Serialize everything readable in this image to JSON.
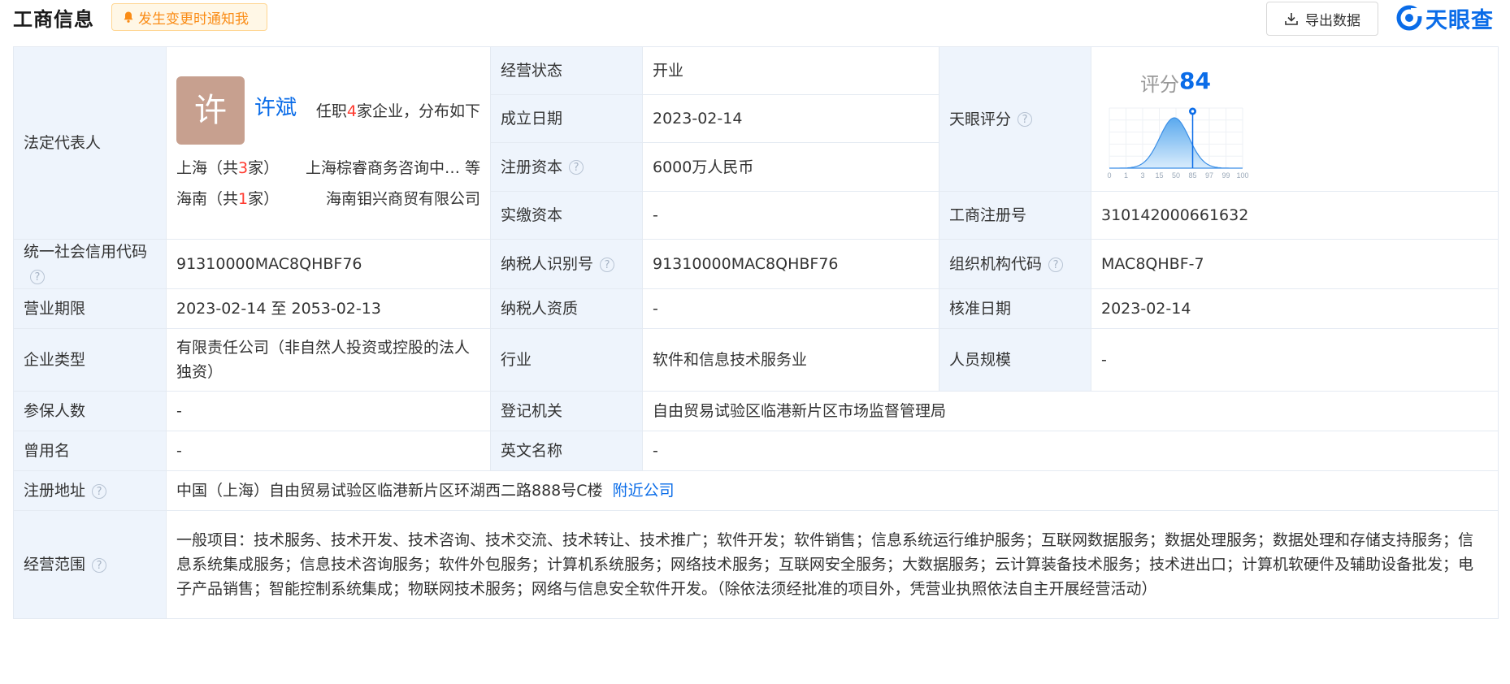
{
  "header": {
    "title": "工商信息",
    "notify_label": "发生变更时通知我",
    "export_label": "导出数据",
    "logo_text": "天眼查"
  },
  "legal_rep": {
    "label": "法定代表人",
    "avatar_char": "许",
    "name": "许斌",
    "pos_prefix": "任职",
    "pos_count": "4",
    "pos_suffix": "家企业，分布如下",
    "regions": [
      {
        "prefix": "上海（共",
        "count": "3",
        "suffix": "家）",
        "company": "上海棕睿商务咨询中…  等"
      },
      {
        "prefix": "海南（共",
        "count": "1",
        "suffix": "家）",
        "company": "海南钼兴商贸有限公司"
      }
    ]
  },
  "fields": {
    "status": {
      "label": "经营状态",
      "value": "开业"
    },
    "established": {
      "label": "成立日期",
      "value": "2023-02-14"
    },
    "reg_capital": {
      "label": "注册资本",
      "value": "6000万人民币"
    },
    "paid_capital": {
      "label": "实缴资本",
      "value": "-"
    },
    "tianyan_score": {
      "label": "天眼评分"
    },
    "reg_no": {
      "label": "工商注册号",
      "value": "310142000661632"
    },
    "credit_code": {
      "label": "统一社会信用代码",
      "value": "91310000MAC8QHBF76"
    },
    "taxpayer_id": {
      "label": "纳税人识别号",
      "value": "91310000MAC8QHBF76"
    },
    "org_code": {
      "label": "组织机构代码",
      "value": "MAC8QHBF-7"
    },
    "term": {
      "label": "营业期限",
      "value": "2023-02-14 至 2053-02-13"
    },
    "taxpayer_qual": {
      "label": "纳税人资质",
      "value": "-"
    },
    "approval_date": {
      "label": "核准日期",
      "value": "2023-02-14"
    },
    "company_type": {
      "label": "企业类型",
      "value": "有限责任公司（非自然人投资或控股的法人独资）"
    },
    "industry": {
      "label": "行业",
      "value": "软件和信息技术服务业"
    },
    "staff_size": {
      "label": "人员规模",
      "value": "-"
    },
    "insured": {
      "label": "参保人数",
      "value": "-"
    },
    "authority": {
      "label": "登记机关",
      "value": "自由贸易试验区临港新片区市场监督管理局"
    },
    "former_name": {
      "label": "曾用名",
      "value": "-"
    },
    "english_name": {
      "label": "英文名称",
      "value": "-"
    },
    "address": {
      "label": "注册地址",
      "value": "中国（上海）自由贸易试验区临港新片区环湖西二路888号C楼",
      "link": "附近公司"
    },
    "scope": {
      "label": "经营范围",
      "value": "一般项目：技术服务、技术开发、技术咨询、技术交流、技术转让、技术推广；软件开发；软件销售；信息系统运行维护服务；互联网数据服务；数据处理服务；数据处理和存储支持服务；信息系统集成服务；信息技术咨询服务；软件外包服务；计算机系统服务；网络技术服务；互联网安全服务；大数据服务；云计算装备技术服务；技术进出口；计算机软硬件及辅助设备批发；电子产品销售；智能控制系统集成；物联网技术服务；网络与信息安全软件开发。（除依法须经批准的项目外，凭营业执照依法自主开展经营活动）"
    }
  },
  "score": {
    "label": "评分",
    "value": "84",
    "x_ticks": [
      "0",
      "1",
      "3",
      "15",
      "50",
      "85",
      "97",
      "99",
      "100"
    ],
    "marker_percent": 85
  },
  "colors": {
    "accent": "#0a6ce8",
    "label_bg": "#eef4fc",
    "highlight": "#ff3b30"
  }
}
